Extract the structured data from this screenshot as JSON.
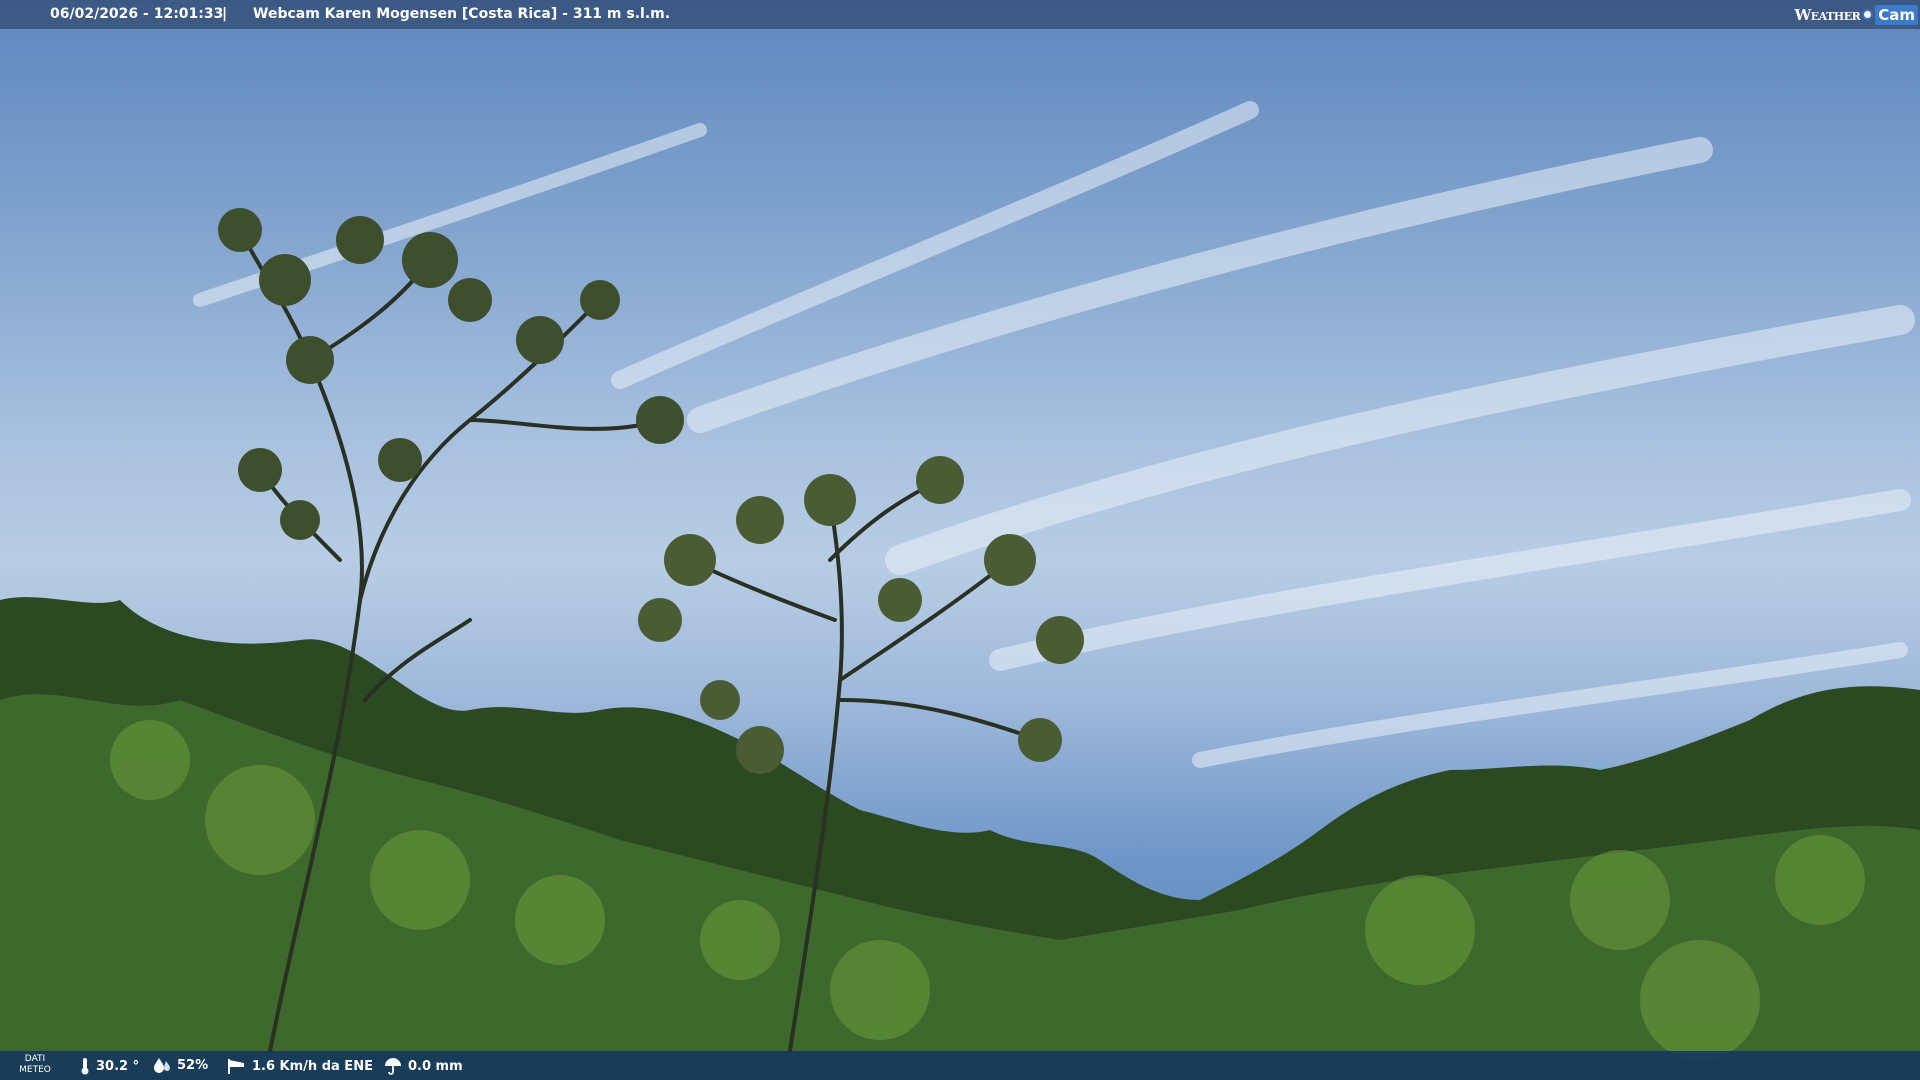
{
  "header": {
    "timestamp": "06/02/2026 - 12:01:33",
    "separator": "|",
    "title": "Webcam Karen Mogensen [Costa Rica] - 311 m s.l.m.",
    "logo": {
      "text_left": "Weather",
      "text_right": "Cam"
    }
  },
  "footer": {
    "meteo_label_line1": "DATI",
    "meteo_label_line2": "METEO",
    "temperature": "30.2 °",
    "humidity": "52%",
    "wind": "1.6 Km/h da ENE",
    "rain": "0.0 mm",
    "icons": [
      "thermometer-icon",
      "humidity-drop-icon",
      "wind-sock-icon",
      "rain-umbrella-icon"
    ]
  },
  "colors": {
    "header_bg": "#3a5680",
    "footer_bg": "#14375f",
    "logo_accent": "#3d7bc8"
  }
}
